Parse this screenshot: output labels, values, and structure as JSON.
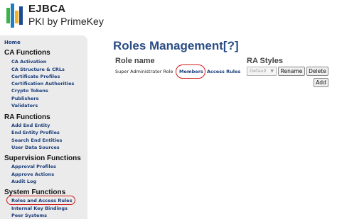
{
  "header": {
    "brand": "EJBCA",
    "subtitle": "PKI by PrimeKey",
    "logo_colors": [
      "#3db24a",
      "#1f7fc1",
      "#f3b021",
      "#1b4a93"
    ]
  },
  "sidebar": {
    "home": "Home",
    "sections": [
      {
        "title": "CA Functions",
        "items": [
          "CA Activation",
          "CA Structure & CRLs",
          "Certificate Profiles",
          "Certification Authorities",
          "Crypto Tokens",
          "Publishers",
          "Validators"
        ]
      },
      {
        "title": "RA Functions",
        "items": [
          "Add End Entity",
          "End Entity Profiles",
          "Search End Entities",
          "User Data Sources"
        ]
      },
      {
        "title": "Supervision Functions",
        "items": [
          "Approval Profiles",
          "Approve Actions",
          "Audit Log"
        ]
      },
      {
        "title": "System Functions",
        "items": [
          "Roles and Access Rules",
          "Internal Key Bindings",
          "Peer Systems"
        ]
      }
    ]
  },
  "main": {
    "title": "Roles Management[?]",
    "columns": [
      "Role name",
      "RA Styles"
    ],
    "roles": [
      {
        "name": "Super Administrator Role",
        "members_link": "Members",
        "access_rules_link": "Access Rules",
        "ra_style": "Default",
        "rename_label": "Rename",
        "delete_label": "Delete"
      }
    ],
    "add_label": "Add"
  },
  "colors": {
    "link": "#1a3d7a",
    "title": "#2a4d84",
    "highlight": "#d11c1c",
    "sidebar_bg": "#ebebeb"
  }
}
